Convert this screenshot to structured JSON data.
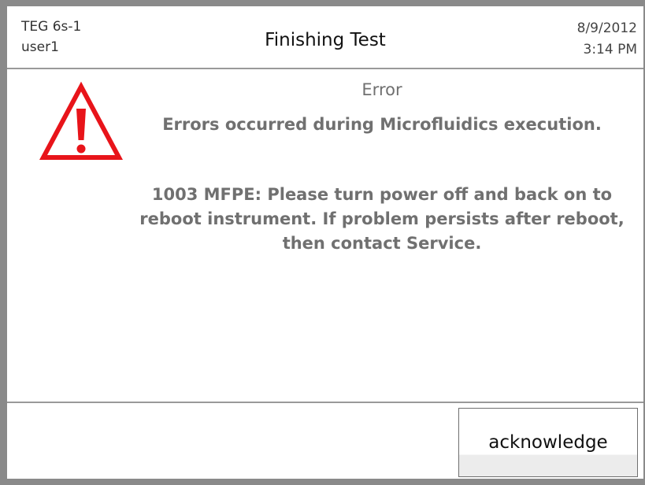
{
  "header": {
    "device_name": "TEG 6s-1",
    "user_name": "user1",
    "title": "Finishing Test",
    "date": "8/9/2012",
    "time": "3:14 PM"
  },
  "message": {
    "icon": "warning-triangle-icon",
    "icon_color": "#e8141a",
    "heading": "Error",
    "summary": "Errors occurred during Microfluidics execution.",
    "detail_lines": [
      "1003 MFPE: Please turn power off and back on to",
      "reboot instrument. If problem persists after reboot,",
      "then contact Service."
    ]
  },
  "footer": {
    "acknowledge_label": "acknowledge"
  }
}
